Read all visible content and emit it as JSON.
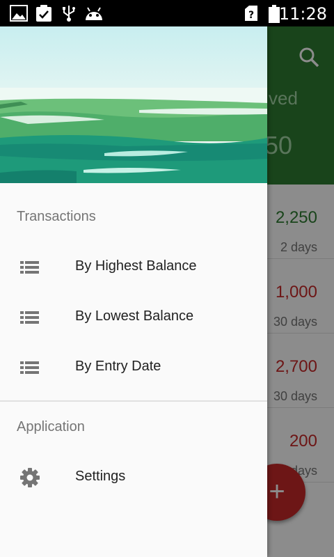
{
  "status_bar": {
    "time": "11:28",
    "icons": [
      "image-icon",
      "clipboard-check-icon",
      "usb-icon",
      "android-icon",
      "sim-unknown-icon",
      "battery-icon"
    ]
  },
  "app": {
    "toolbar_color": "#2e7d32",
    "label_fragment": "ved",
    "total_fragment": "50",
    "rows": [
      {
        "amount": "2,250",
        "days": "2 days",
        "color": "#2e7d32"
      },
      {
        "amount": "1,000",
        "days": "30 days",
        "color": "#c62828"
      },
      {
        "amount": "2,700",
        "days": "30 days",
        "color": "#c62828"
      },
      {
        "amount": "200",
        "days": "days",
        "color": "#c62828"
      }
    ],
    "fab_label": "+",
    "fab_color": "#c62828"
  },
  "drawer": {
    "section_transactions": "Transactions",
    "items": [
      {
        "label": "By Highest Balance",
        "icon": "list-icon"
      },
      {
        "label": "By Lowest Balance",
        "icon": "list-icon"
      },
      {
        "label": "By Entry Date",
        "icon": "list-icon"
      }
    ],
    "section_application": "Application",
    "settings": {
      "label": "Settings",
      "icon": "gear-icon"
    }
  }
}
